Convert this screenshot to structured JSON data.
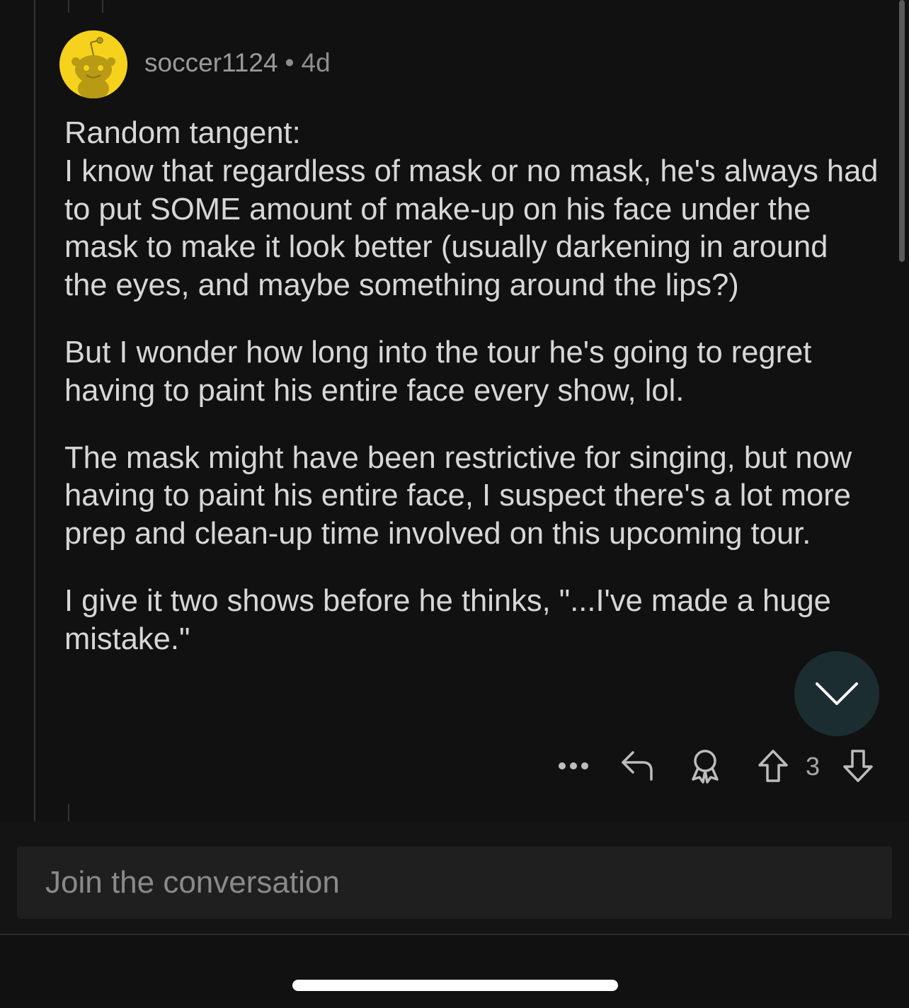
{
  "comment": {
    "username": "soccer1124",
    "separator": "•",
    "age": "4d",
    "paragraphs": [
      "Random tangent:\nI know that regardless of mask or no mask, he's always had to put SOME amount of make-up on his face under the mask to make it look better (usually darkening in around the eyes, and maybe something around the lips?)",
      "But I wonder how long into the tour he's going to regret having to paint his entire face every show, lol.",
      "The mask might have been restrictive for singing, but now having to paint his entire face, I suspect there's a lot more prep and clean-up time involved on this upcoming tour.",
      "I give it two shows before he thinks, \"...I've made a huge mistake.\""
    ],
    "vote_count": "3"
  },
  "actions": {
    "more_icon": "more-dots-icon",
    "reply_icon": "reply-arrow-icon",
    "award_icon": "award-icon",
    "upvote_icon": "upvote-arrow-icon",
    "downvote_icon": "downvote-arrow-icon"
  },
  "fab": {
    "icon": "chevron-down-icon",
    "color": "#1b2d31"
  },
  "composer": {
    "placeholder": "Join the conversation"
  },
  "colors": {
    "background": "#111111",
    "avatar": "#f6d21c",
    "text": "#d7d7d7",
    "meta": "#8e8e8e"
  }
}
